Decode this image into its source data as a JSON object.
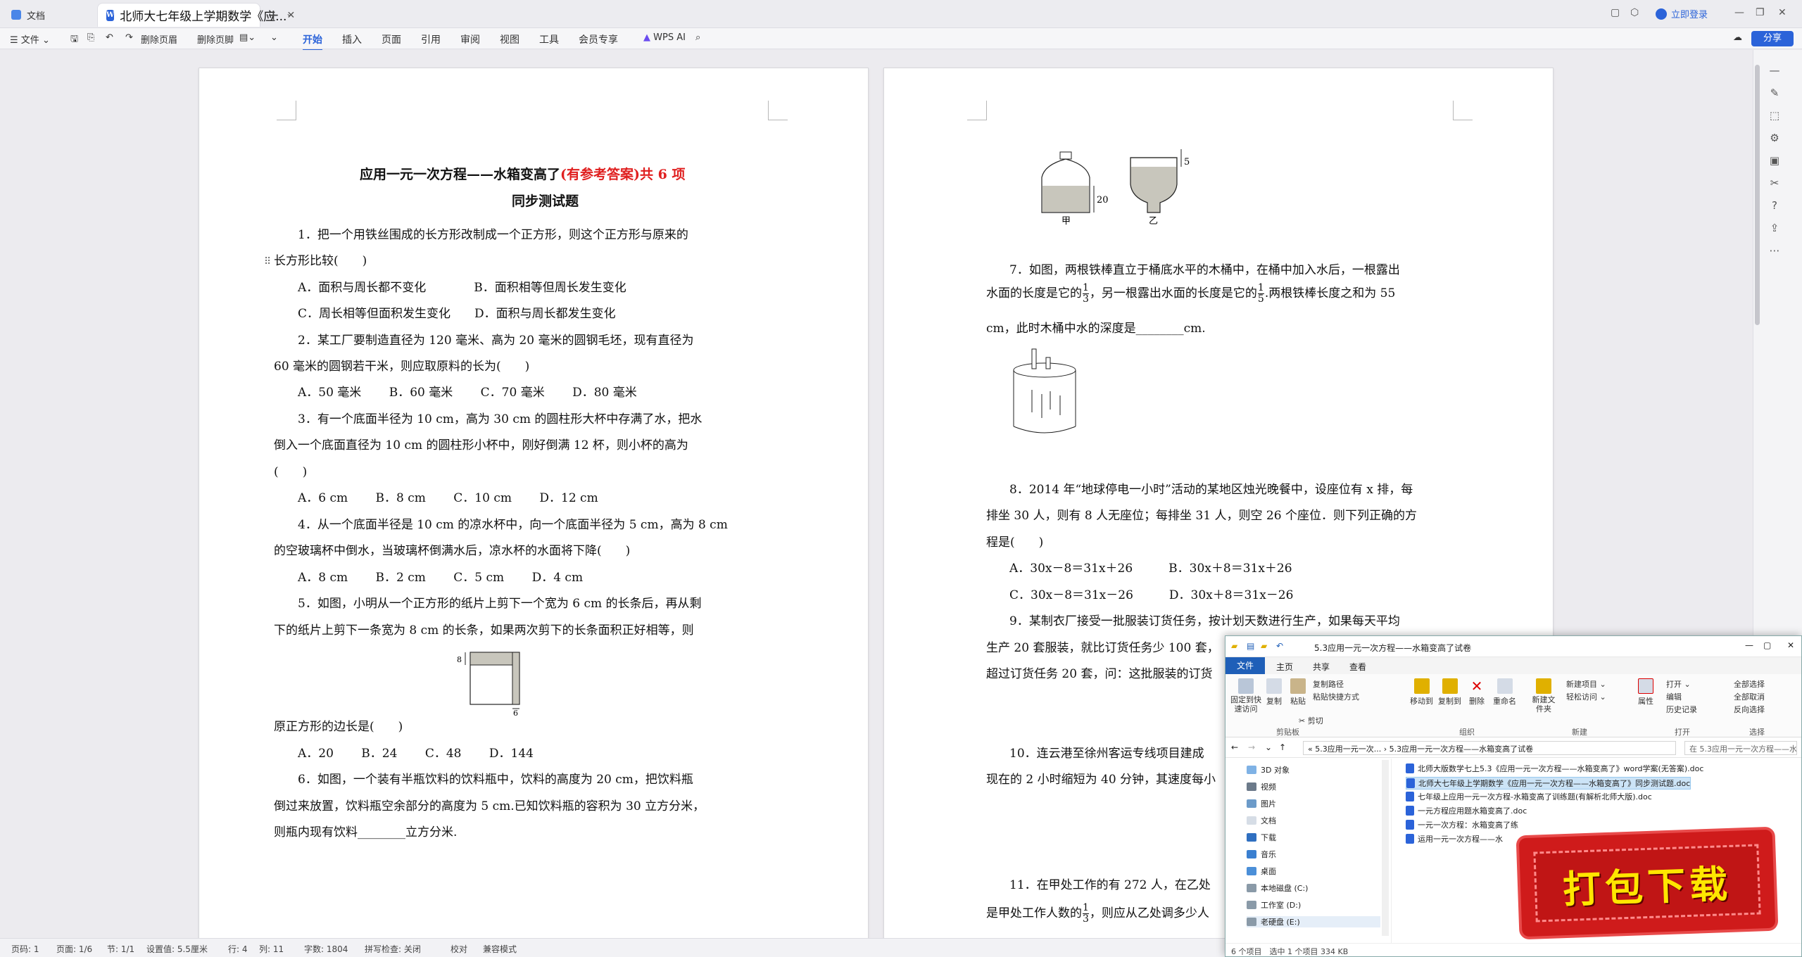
{
  "tabs": {
    "home": "文档",
    "doc": "北师大七年级上学期数学《应..."
  },
  "titlebar": {
    "login": "立即登录"
  },
  "toolbar": {
    "file": "文件",
    "del_header": "删除页眉",
    "del_footer": "删除页脚",
    "menus": [
      "开始",
      "插入",
      "页面",
      "引用",
      "审阅",
      "视图",
      "工具",
      "会员专享"
    ],
    "wps_ai": "WPS AI",
    "share": "分享"
  },
  "page1": {
    "title": "应用一元一次方程——水箱变高了",
    "title_red": "(有参考答案)",
    "title_tail": "共 6 项",
    "subtitle": "同步测试题",
    "lines": [
      "1．把一个用铁丝围成的长方形改制成一个正方形，则这个正方形与原来的",
      "长方形比较(　　)",
      "A．面积与周长都不变化　　　　B．面积相等但周长发生变化",
      "C．周长相等但面积发生变化　　D．面积与周长都发生变化",
      "2．某工厂要制造直径为 120 毫米、高为 20 毫米的圆钢毛坯，现有直径为",
      "60 毫米的圆钢若干米，则应取原料的长为(　　)",
      "A．50 毫米　　 B．60 毫米　　 C．70 毫米　　 D．80 毫米",
      "3．有一个底面半径为 10 cm，高为 30 cm 的圆柱形大杯中存满了水，把水",
      "倒入一个底面直径为 10 cm 的圆柱形小杯中，刚好倒满 12 杯，则小杯的高为",
      "(　　)",
      "A．6 cm　　 B．8 cm　　 C．10 cm　　 D．12 cm",
      "4．从一个底面半径是 10 cm 的凉水杯中，向一个底面半径为 5 cm，高为 8 cm",
      "的空玻璃杯中倒水，当玻璃杯倒满水后，凉水杯的水面将下降(　　)",
      "A．8 cm　　 B．2 cm　　 C．5 cm　　 D．4 cm",
      "5．如图，小明从一个正方形的纸片上剪下一个宽为 6 cm 的长条后，再从剩",
      "下的纸片上剪下一条宽为 8 cm 的长条，如果两次剪下的长条面积正好相等，则",
      "原正方形的边长是(　　)",
      "A．20　　 B．24　　 C．48　　 D．144",
      "6．如图，一个装有半瓶饮料的饮料瓶中，饮料的高度为 20 cm，把饮料瓶",
      "倒过来放置，饮料瓶空余部分的高度为 5 cm.已知饮料瓶的容积为 30 立方分米，",
      "则瓶内现有饮料________立方分米."
    ],
    "fig5": {
      "top": "8",
      "bottom": "6"
    }
  },
  "page2": {
    "fig6": {
      "left": "甲",
      "right": "乙",
      "h1": "20",
      "h2": "5"
    },
    "q7": {
      "a": "7．如图，两根铁棒直立于桶底水平的木桶中，在桶中加入水后，一根露出",
      "b1": "水面的长度是它的",
      "b2": "，另一根露出水面的长度是它的",
      "b3": ".两根铁棒长度之和为 55",
      "f1n": "1",
      "f1d": "3",
      "f2n": "1",
      "f2d": "5",
      "c": "cm，此时木桶中水的深度是________cm."
    },
    "lines": [
      "8．2014 年“地球停电一小时”活动的某地区烛光晚餐中，设座位有 x 排，每",
      "排坐 30 人，则有 8 人无座位；每排坐 31 人，则空 26 个座位．则下列正确的方",
      "程是(　　)",
      "A．30x－8＝31x＋26　　　B．30x＋8＝31x＋26",
      "C．30x－8＝31x－26　　　D．30x＋8＝31x－26",
      "9．某制衣厂接受一批服装订货任务，按计划天数进行生产，如果每天平均",
      "生产 20 套服装，就比订货任务少 100 套，",
      "超过订货任务 20 套，问：这批服装的订货",
      "10．连云港至徐州客运专线项目建成",
      "现在的 2 小时缩短为 40 分钟，其速度每小",
      "11．在甲处工作的有 272 人，在乙处",
      "是甲处工作人数的",
      "，则应从乙处调多少人"
    ],
    "q11f": {
      "n": "1",
      "d": "3"
    }
  },
  "status": {
    "page": "页码: 1",
    "pages": "页面: 1/6",
    "section": "节: 1/1",
    "setting": "设置值: 5.5厘米",
    "row": "行: 4",
    "col": "列: 11",
    "words": "字数: 1804",
    "spell": "拼写检查: 关闭",
    "proof": "校对",
    "compat": "兼容模式"
  },
  "explorer": {
    "title": "5.3应用一元一次方程——水箱变高了试卷",
    "tabs": [
      "文件",
      "主页",
      "共享",
      "查看"
    ],
    "ribbon": {
      "pin": "固定到快速访问",
      "copy": "复制",
      "paste": "粘贴",
      "copy_path": "复制路径",
      "paste_shortcut": "粘贴快捷方式",
      "cut": "剪切",
      "move_to": "移动到",
      "copy_to": "复制到",
      "delete": "删除",
      "rename": "重命名",
      "new_folder": "新建文件夹",
      "new_item": "新建项目",
      "easy_access": "轻松访问",
      "properties": "属性",
      "open": "打开",
      "edit": "编辑",
      "history": "历史记录",
      "select_all": "全部选择",
      "select_none": "全部取消",
      "invert": "反向选择",
      "groups": [
        "剪贴板",
        "组织",
        "新建",
        "打开",
        "选择"
      ]
    },
    "path": "« 5.3应用一元一次... › 5.3应用一元一次方程——水箱变高了试卷",
    "search": "在 5.3应用一元一次方程——水箱...",
    "tree": [
      "3D 对象",
      "视频",
      "图片",
      "文档",
      "下载",
      "音乐",
      "桌面",
      "本地磁盘 (C:)",
      "工作室 (D:)",
      "老硬盘 (E:)"
    ],
    "files": [
      "北师大版数学七上5.3《应用一元一次方程——水箱变高了》word学案(无答案).doc",
      "北师大七年级上学期数学《应用一元一次方程——水箱变高了》同步测试题.doc",
      "七年级上应用一元一次方程-水箱变高了训练题(有解析北师大版).doc",
      "一元方程应用题水箱变高了.doc",
      "一元一次方程：水箱变高了练",
      "运用一元一次方程——水"
    ],
    "status": "6 个项目　选中 1 个项目 334 KB"
  },
  "banner": "打包下载"
}
